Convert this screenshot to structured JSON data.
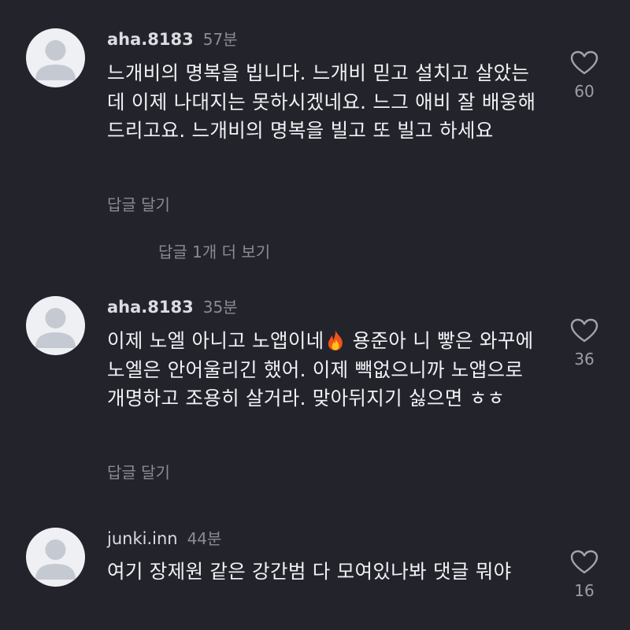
{
  "comments": [
    {
      "username": "aha.8183",
      "time": "57분",
      "text": "느개비의 명복을 빕니다. 느개비 믿고 설치고 살았는데 이제 나대지는 못하시겠네요. 느그 애비 잘 배웅해드리고요. 느개비의 명복을 빌고 또 빌고 하세요",
      "reply_label": "답글 달기",
      "like_count": "60",
      "view_replies_label": "답글 1개 더 보기"
    },
    {
      "username": "aha.8183",
      "time": "35분",
      "text_before_emoji": "이제 노엘 아니고 노앱이네",
      "emoji": "fire-emoji",
      "text_after_emoji": " 용준아 니 빻은 와꾸에 노엘은 안어울리긴 했어. 이제 빽없으니까 노앱으로 개명하고 조용히 살거라. 맞아뒤지기 싫으면 ㅎㅎ",
      "reply_label": "답글 달기",
      "like_count": "36"
    },
    {
      "username": "junki.inn",
      "time": "44분",
      "text": "여기 장제원 같은 강간범 다 모여있나봐 댓글 뭐야",
      "like_count": "16"
    }
  ],
  "icons": {
    "avatar": "default-user-avatar",
    "like": "heart-outline-icon"
  },
  "colors": {
    "background": "#23242b",
    "text": "#f1f2f5",
    "secondary_text": "#8a8b93",
    "avatar_bg": "#eef0f3",
    "avatar_silhouette": "#c5c9d1"
  }
}
